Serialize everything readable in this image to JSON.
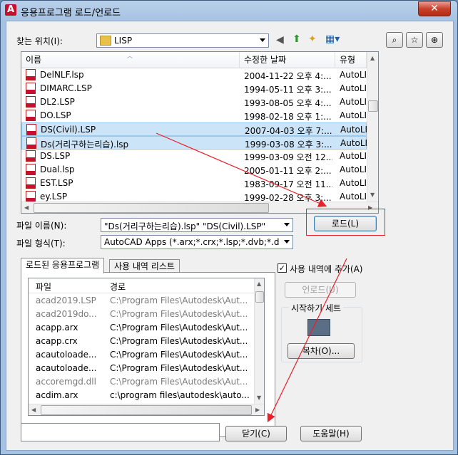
{
  "window": {
    "title": "응용프로그램 로드/언로드",
    "close_glyph": "✕"
  },
  "lookin": {
    "label": "찾는 위치(I):",
    "value": "LISP"
  },
  "columns": {
    "name": "이름",
    "date": "수정한 날짜",
    "type": "유형"
  },
  "files": [
    {
      "name": "DelNLF.lsp",
      "date": "2004-11-22 오후 4:...",
      "type": "AutoLIS"
    },
    {
      "name": "DIMARC.LSP",
      "date": "1994-05-11 오후 3:...",
      "type": "AutoLIS"
    },
    {
      "name": "DL2.LSP",
      "date": "1993-08-05 오후 4:...",
      "type": "AutoLIS"
    },
    {
      "name": "DO.LSP",
      "date": "1998-02-18 오후 1:...",
      "type": "AutoLIS"
    },
    {
      "name": "DS(Civil).LSP",
      "date": "2007-04-03 오후 7:...",
      "type": "AutoLIS"
    },
    {
      "name": "Ds(거리구하는리습).lsp",
      "date": "1999-03-08 오후 3:...",
      "type": "AutoLIS"
    },
    {
      "name": "DS.LSP",
      "date": "1999-03-09 오전 12...",
      "type": "AutoLIS"
    },
    {
      "name": "Dual.lsp",
      "date": "2005-01-11 오후 2:...",
      "type": "AutoLIS"
    },
    {
      "name": "EST.LSP",
      "date": "1983-09-17 오전 11...",
      "type": "AutoLIS"
    },
    {
      "name": "ey.LSP",
      "date": "1999-02-28 오후 3:...",
      "type": "AutoLIS"
    }
  ],
  "filename": {
    "label": "파일 이름(N):",
    "value": "\"Ds(거리구하는리습).lsp\" \"DS(Civil).LSP\""
  },
  "filetype": {
    "label": "파일 형식(T):",
    "value": "AutoCAD Apps (*.arx;*.crx;*.lsp;*.dvb;*.dbx"
  },
  "buttons": {
    "load": "로드(L)",
    "unload": "언로드(U)",
    "contents": "목차(O)...",
    "close": "닫기(C)",
    "help": "도움말(H)"
  },
  "tabs": {
    "loaded": "로드된 응용프로그램",
    "history": "사용 내역 리스트"
  },
  "applist": {
    "col_file": "파일",
    "col_path": "경로",
    "rows": [
      {
        "file": "acad2019.LSP",
        "path": "C:\\Program Files\\Autodesk\\Aut...",
        "dim": true
      },
      {
        "file": "acad2019do...",
        "path": "C:\\Program Files\\Autodesk\\Aut...",
        "dim": true
      },
      {
        "file": "acapp.arx",
        "path": "C:\\Program Files\\Autodesk\\Aut...",
        "dim": false
      },
      {
        "file": "acapp.crx",
        "path": "C:\\Program Files\\Autodesk\\Aut...",
        "dim": false
      },
      {
        "file": "acautoloade...",
        "path": "C:\\Program Files\\Autodesk\\Aut...",
        "dim": false
      },
      {
        "file": "acautoloade...",
        "path": "C:\\Program Files\\Autodesk\\Aut...",
        "dim": false
      },
      {
        "file": "accoremgd.dll",
        "path": "C:\\Program Files\\Autodesk\\Aut...",
        "dim": true
      },
      {
        "file": "acdim.arx",
        "path": "c:\\program files\\autodesk\\auto...",
        "dim": false
      }
    ]
  },
  "history_checkbox": {
    "label": "사용 내역에 추가(A)",
    "checked": "✓"
  },
  "startup": {
    "label": "시작하기 세트"
  },
  "colors": {
    "annotation": "#e8202a",
    "selection": "#cce4f7"
  }
}
